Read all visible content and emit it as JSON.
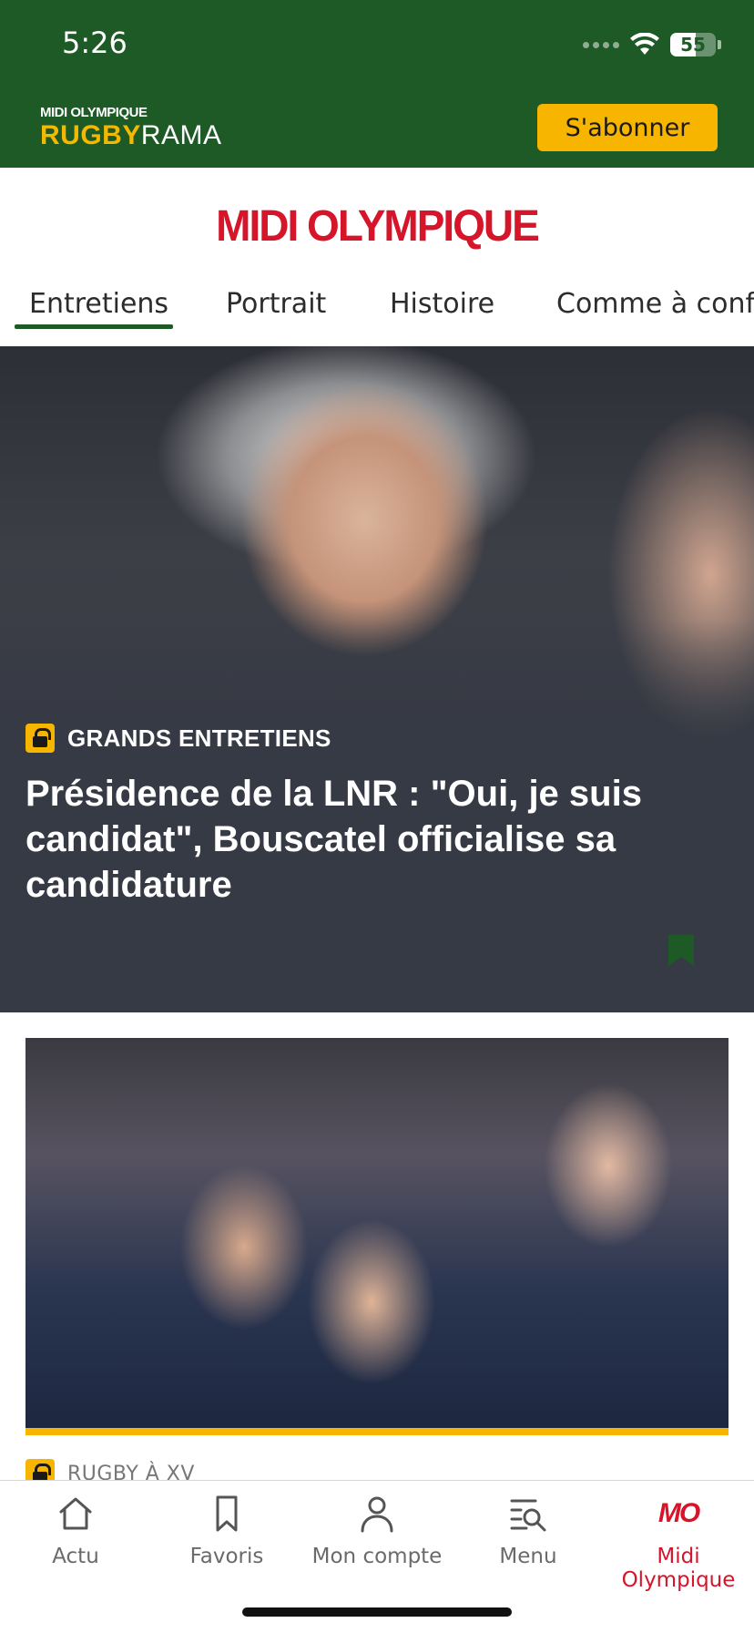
{
  "status_bar": {
    "time": "5:26",
    "battery": "55",
    "battery_fraction": 0.55
  },
  "header": {
    "brand_top": "MIDI OLYMPIQUE",
    "brand_bold": "RUGBY",
    "brand_light": "RAMA",
    "subscribe_label": "S'abonner"
  },
  "masthead": {
    "title": "MIDI OLYMPIQUE"
  },
  "tabs": [
    {
      "label": "Entretiens",
      "active": true
    },
    {
      "label": "Portrait"
    },
    {
      "label": "Histoire"
    },
    {
      "label": "Comme à confesse"
    }
  ],
  "hero": {
    "category": "GRANDS ENTRETIENS",
    "title": "Présidence de la LNR : \"Oui, je suis candidat\", Bouscatel officialise sa candidature",
    "premium": true
  },
  "second_article": {
    "category": "RUGBY À XV",
    "premium": true
  },
  "bottom_nav": [
    {
      "label": "Actu",
      "icon": "home-icon"
    },
    {
      "label": "Favoris",
      "icon": "bookmark-icon"
    },
    {
      "label": "Mon compte",
      "icon": "user-icon"
    },
    {
      "label": "Menu",
      "icon": "menu-search-icon"
    },
    {
      "label": "Midi Olympique",
      "icon": "mo-logo",
      "logo_text": "MO",
      "active": true
    }
  ],
  "colors": {
    "header_green": "#1e5a25",
    "accent_yellow": "#f7b500",
    "brand_red": "#d6142a",
    "hero_bg": "#363a44"
  }
}
